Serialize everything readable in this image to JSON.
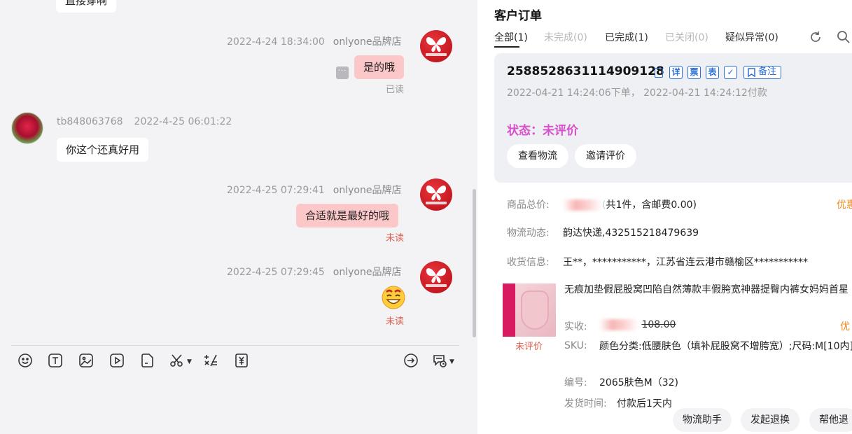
{
  "chat": {
    "top_partial_text": "直接穿啊",
    "messages": [
      {
        "time": "2022-4-24 18:34:00",
        "sender": "onlyone品牌店",
        "text": "是的哦",
        "read_status": "已读"
      },
      {
        "sender": "tb848063768",
        "time": "2022-4-25 06:01:22",
        "text": "你这个还真好用"
      },
      {
        "time": "2022-4-25 07:29:41",
        "sender": "onlyone品牌店",
        "text": "合适就是最好的哦",
        "read_status": "未读"
      },
      {
        "time": "2022-4-25 07:29:45",
        "sender": "onlyone品牌店",
        "emoji": "😊",
        "read_status": "未读"
      }
    ],
    "more_glyph": "···",
    "toolbar_icons": [
      "emoji-icon",
      "text-icon",
      "image-icon",
      "video-icon",
      "file-icon",
      "scissors-icon",
      "formula-icon",
      "coupon-icon",
      "transfer-icon",
      "quick-reply-icon"
    ]
  },
  "order": {
    "title": "客户订单",
    "tabs": [
      {
        "label": "全部(1)",
        "state": "active"
      },
      {
        "label": "未完成(0)",
        "state": "dim"
      },
      {
        "label": "已完成(1)",
        "state": "normal"
      },
      {
        "label": "已关闭(0)",
        "state": "dim"
      },
      {
        "label": "疑似异常(0)",
        "state": "normal"
      }
    ],
    "order_no": "2588528631114909128",
    "action_icons": [
      "详",
      "票",
      "表",
      "✓"
    ],
    "remark_label": "备注",
    "times": "2022-04-21 14:24:06下单， 2022-04-21 14:24:12付款",
    "status": "状态：未评价",
    "buttons": [
      "查看物流",
      "邀请评价"
    ],
    "total_label": "商品总价:",
    "total_suffix": "共1件，含邮费0.00)",
    "promo_label": "优惠",
    "logistics_label": "物流动态:",
    "logistics_value": "韵达快递,432515218479639",
    "address_label": "收货信息:",
    "address_value": "王**，***********，江苏省连云港市赣榆区***********",
    "product": {
      "title": "无痕加垫假屁股窝凹陷自然薄款丰假胯宽神器提臀内裤女妈妈首星",
      "review_status": "未评价",
      "paid_label": "实收:",
      "original_price": "108.00",
      "promo_short": "优",
      "sku_label": "SKU:",
      "sku_value": "颜色分类:低腰肤色（填补屁股窝不增胯宽）;尺码:M[10内]",
      "code_label": "编号:",
      "code_value": "2065肤色M（32)",
      "ship_label": "发货时间:",
      "ship_value": "付款后1天内"
    },
    "bottom_buttons": [
      "物流助手",
      "发起退换",
      "帮他退"
    ]
  },
  "colors": {
    "bubble_out": "#fcc7c8",
    "unread": "#e0604f",
    "status": "#d94fcd",
    "accent": "#2c6fd6",
    "promo": "#f08a1c"
  }
}
